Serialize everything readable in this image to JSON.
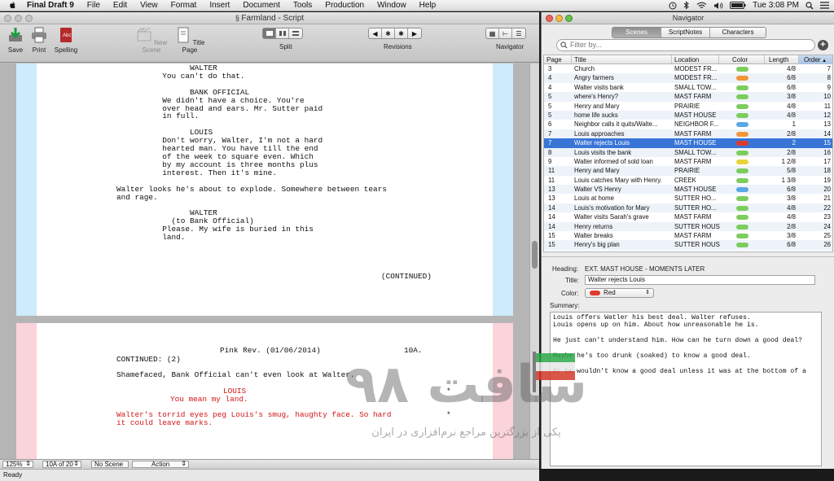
{
  "menubar": {
    "app_name": "Final Draft 9",
    "items": [
      "File",
      "Edit",
      "View",
      "Format",
      "Insert",
      "Document",
      "Tools",
      "Production",
      "Window",
      "Help"
    ],
    "clock": "Tue 3:08 PM"
  },
  "script_window": {
    "title": "Farmland - Script",
    "toolbar": {
      "save": "Save",
      "print": "Print",
      "spelling": "Spelling",
      "new_scene": "New Scene",
      "title_page": "Title Page",
      "split": "Split",
      "revisions": "Revisions",
      "navigator": "Navigator"
    },
    "page1_lines": [
      "                WALTER",
      "          You can't do that.",
      "",
      "                BANK OFFICIAL",
      "          We didn't have a choice. You're",
      "          over head and ears. Mr. Sutter paid",
      "          in full.",
      "",
      "                LOUIS",
      "          Don't worry, Walter, I'm not a hard",
      "          hearted man. You have till the end",
      "          of the week to square even. Which",
      "          by my account is three months plus",
      "          interest. Then it's mine.",
      "",
      "Walter looks he's about to explode. Somewhere between tears",
      "and rage.",
      "",
      "                WALTER",
      "            (to Bank Official)",
      "          Please. My wife is buried in this",
      "          land."
    ],
    "page1_continued": "(CONTINUED)",
    "page2_header": "Pink Rev. (01/06/2014)",
    "page2_number": "10A.",
    "page2_continued": "CONTINUED: (2)",
    "page2_action1": "Shamefaced, Bank Official can't even look at Walter.",
    "page2_char": "LOUIS",
    "page2_dialogue": "You mean my land.",
    "page2_action2_l1": "Walter's torrid eyes peg Louis's smug, haughty face. So hard",
    "page2_action2_l2": "it could leave marks.",
    "revision_mark": "*",
    "status": {
      "zoom": "125%",
      "page": "10A of 20",
      "scene": "No Scene",
      "element": "Action"
    },
    "ready": "Ready"
  },
  "navigator": {
    "title": "Navigator",
    "tabs": [
      "Scenes",
      "ScriptNotes",
      "Characters"
    ],
    "filter_placeholder": "Filter by...",
    "columns": [
      "Page",
      "Title",
      "Location",
      "Color",
      "Length",
      "Order"
    ],
    "rows": [
      {
        "page": "3",
        "title": "Church",
        "location": "MODEST FR...",
        "color": "#7ccd5e",
        "length": "4/8",
        "order": "7"
      },
      {
        "page": "4",
        "title": "Angry farmers",
        "location": "MODEST FR...",
        "color": "#f2963a",
        "length": "6/8",
        "order": "8"
      },
      {
        "page": "4",
        "title": "Walter visits bank",
        "location": "SMALL TOW...",
        "color": "#7ccd5e",
        "length": "6/8",
        "order": "9"
      },
      {
        "page": "5",
        "title": "where's Henry?",
        "location": "MAST FARM",
        "color": "#7ccd5e",
        "length": "3/8",
        "order": "10"
      },
      {
        "page": "5",
        "title": "Henry and Mary",
        "location": "PRAIRIE",
        "color": "#7ccd5e",
        "length": "4/8",
        "order": "11"
      },
      {
        "page": "5",
        "title": "home life sucks",
        "location": "MAST HOUSE",
        "color": "#7ccd5e",
        "length": "4/8",
        "order": "12"
      },
      {
        "page": "6",
        "title": "Neighbor calls it quits/Walte...",
        "location": "NEIGHBOR F...",
        "color": "#5aa8e6",
        "length": "1",
        "order": "13"
      },
      {
        "page": "7",
        "title": "Louis approaches",
        "location": "MAST FARM",
        "color": "#f2963a",
        "length": "2/8",
        "order": "14"
      },
      {
        "page": "7",
        "title": "Walter rejects Louis",
        "location": "MAST HOUSE",
        "color": "#e03a2c",
        "length": "2",
        "order": "15",
        "selected": true
      },
      {
        "page": "8",
        "title": "Louis visits the bank",
        "location": "SMALL TOW...",
        "color": "#7ccd5e",
        "length": "2/8",
        "order": "16"
      },
      {
        "page": "9",
        "title": "Walter informed of sold loan",
        "location": "MAST FARM",
        "color": "#e8d43a",
        "length": "1 2/8",
        "order": "17"
      },
      {
        "page": "11",
        "title": "Henry and Mary",
        "location": "PRAIRIE",
        "color": "#7ccd5e",
        "length": "5/8",
        "order": "18"
      },
      {
        "page": "11",
        "title": "Louis catches Mary with Henry.",
        "location": "CREEK",
        "color": "#7ccd5e",
        "length": "1 3/8",
        "order": "19"
      },
      {
        "page": "13",
        "title": "Walter VS Henry",
        "location": "MAST HOUSE",
        "color": "#5aa8e6",
        "length": "6/8",
        "order": "20"
      },
      {
        "page": "13",
        "title": "Louis at home",
        "location": "SUTTER HO...",
        "color": "#7ccd5e",
        "length": "3/8",
        "order": "21"
      },
      {
        "page": "14",
        "title": "Louis's motivation for Mary",
        "location": "SUTTER HO...",
        "color": "#7ccd5e",
        "length": "4/8",
        "order": "22"
      },
      {
        "page": "14",
        "title": "Walter visits Sarah's grave",
        "location": "MAST FARM",
        "color": "#7ccd5e",
        "length": "4/8",
        "order": "23"
      },
      {
        "page": "14",
        "title": "Henry returns",
        "location": "SUTTER HOUSE",
        "color": "#7ccd5e",
        "length": "2/8",
        "order": "24"
      },
      {
        "page": "15",
        "title": "Walter breaks",
        "location": "MAST FARM",
        "color": "#7ccd5e",
        "length": "3/8",
        "order": "25"
      },
      {
        "page": "15",
        "title": "Henry's big plan",
        "location": "SUTTER HOUSE",
        "color": "#7ccd5e",
        "length": "6/8",
        "order": "26"
      }
    ],
    "details": {
      "heading_label": "Heading:",
      "heading_value": "EXT. MAST HOUSE - MOMENTS LATER",
      "title_label": "Title:",
      "title_value": "Walter rejects Louis",
      "color_label": "Color:",
      "color_value": "Red",
      "color_swatch": "#e03a2c",
      "summary_label": "Summary:",
      "summary_text": "Louis offers Watler his best deal. Walter refuses.\nLouis opens up on him. About how unreasonable he is.\n\nHe just can't understand him. How can he turn down a good deal?\n\nMaybe he's too drunk (soaked) to know a good deal.\n\nOr he wouldn't know a good deal unless it was at the bottom of a"
    }
  },
  "watermark": {
    "brand": "سافت ۹۸",
    "tagline": "یکی از بزرگترین مراجع نرم‌افزاری در ایران"
  },
  "colors": {
    "page1_margin": "#cdebfa",
    "page2_margin": "#fbd3da",
    "selection": "#3875d7",
    "revision_red": "#d21515"
  }
}
